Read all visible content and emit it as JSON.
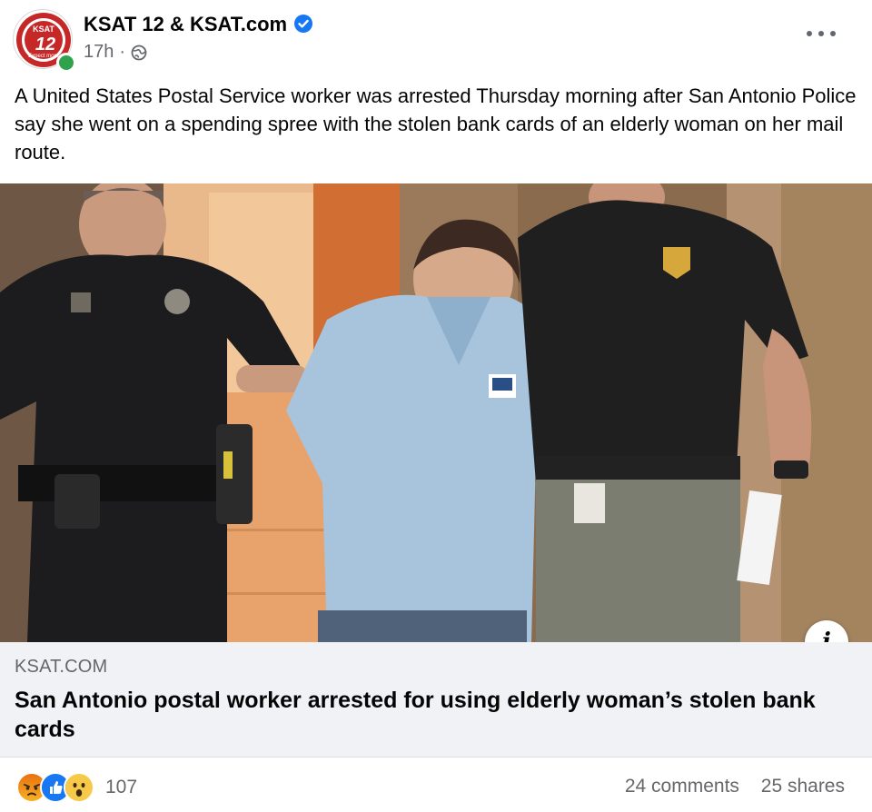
{
  "post": {
    "page_name": "KSAT 12 & KSAT.com",
    "time": "17h",
    "dot": "·",
    "caption": "A United States Postal Service worker was arrested Thursday morning after San Antonio Police say she went on a spending spree with the stolen bank cards of an elderly woman on her mail route.",
    "avatar_text": "KSAT",
    "avatar_number": "12",
    "avatar_tag": "Expect more"
  },
  "link": {
    "domain": "KSAT.COM",
    "title": "San Antonio postal worker arrested for using elderly woman’s stolen bank cards",
    "info_label": "i"
  },
  "engagement": {
    "reactions": [
      "angry-reaction-icon",
      "like-reaction-icon",
      "wow-reaction-icon"
    ],
    "reaction_count": "107",
    "comments": "24 comments",
    "shares": "25 shares"
  },
  "colors": {
    "verified": "#1877f2",
    "online": "#31a24c",
    "secondary_text": "#65676b",
    "card_bg": "#f0f2f5"
  }
}
